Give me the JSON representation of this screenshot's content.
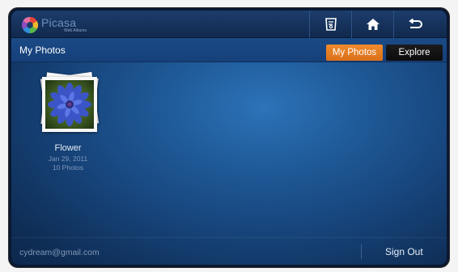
{
  "app": {
    "logo_title": "Picasa",
    "logo_subtitle": "Web Albums"
  },
  "toolbar": {
    "buttons": [
      {
        "icon": "settings-icon"
      },
      {
        "icon": "home-icon"
      },
      {
        "icon": "back-icon"
      }
    ]
  },
  "header": {
    "title": "My Photos",
    "tabs": [
      {
        "label": "My Photos",
        "active": true
      },
      {
        "label": "Explore",
        "active": false
      }
    ]
  },
  "albums": [
    {
      "name": "Flower",
      "date": "Jan 29, 2011",
      "count": "10 Photos"
    }
  ],
  "footer": {
    "email": "cydream@gmail.com",
    "sign_out": "Sign Out"
  },
  "colors": {
    "accent": "#e57e22",
    "background": "#1d5592",
    "topbar": "#15305a"
  }
}
